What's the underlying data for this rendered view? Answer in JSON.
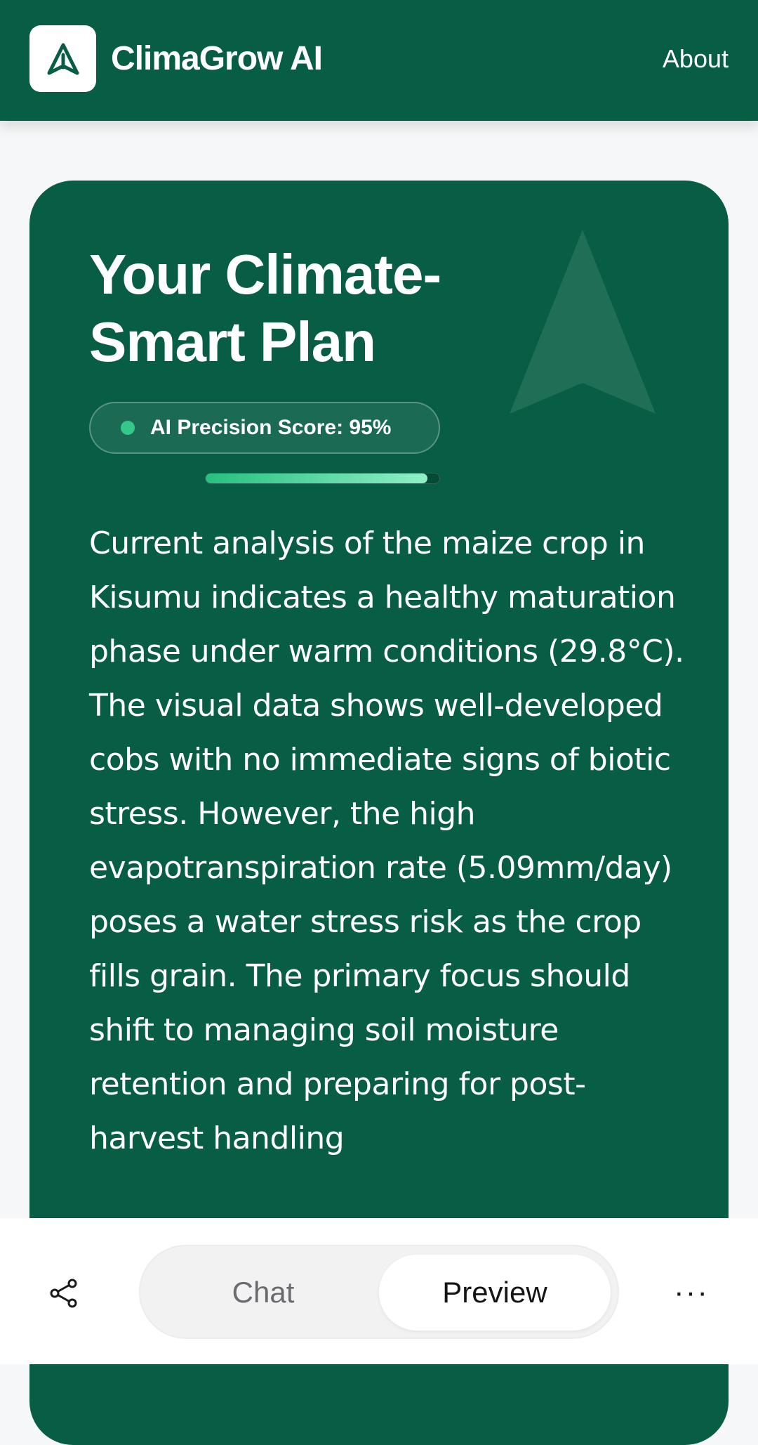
{
  "header": {
    "app_name": "ClimaGrow AI",
    "about_label": "About",
    "logo_icon": "leaf-triangle-icon",
    "bg_color": "#075e45"
  },
  "plan_card": {
    "title": "Your Climate-Smart Plan",
    "score_label": "AI Precision Score: 95%",
    "score_value_percent": 95,
    "progress_fraction": 0.95,
    "analysis_text": "Current analysis of the maize crop in Kisumu indicates a healthy maturation phase under warm conditions (29.8°C). The visual data shows well-developed cobs with no immediate signs of biotic stress. However, the high evapotranspiration rate (5.09mm/day) poses a water stress risk as the crop fills grain. The primary focus should shift to managing soil moisture retention and preparing for post-harvest handling",
    "accent_color": "#34c98a",
    "bg_color": "#085e45"
  },
  "bottom_bar": {
    "share_icon": "share-icon",
    "tabs": [
      {
        "label": "Chat",
        "selected": false
      },
      {
        "label": "Preview",
        "selected": true
      }
    ],
    "more_icon": "more-dots-icon",
    "more_label": "···"
  }
}
